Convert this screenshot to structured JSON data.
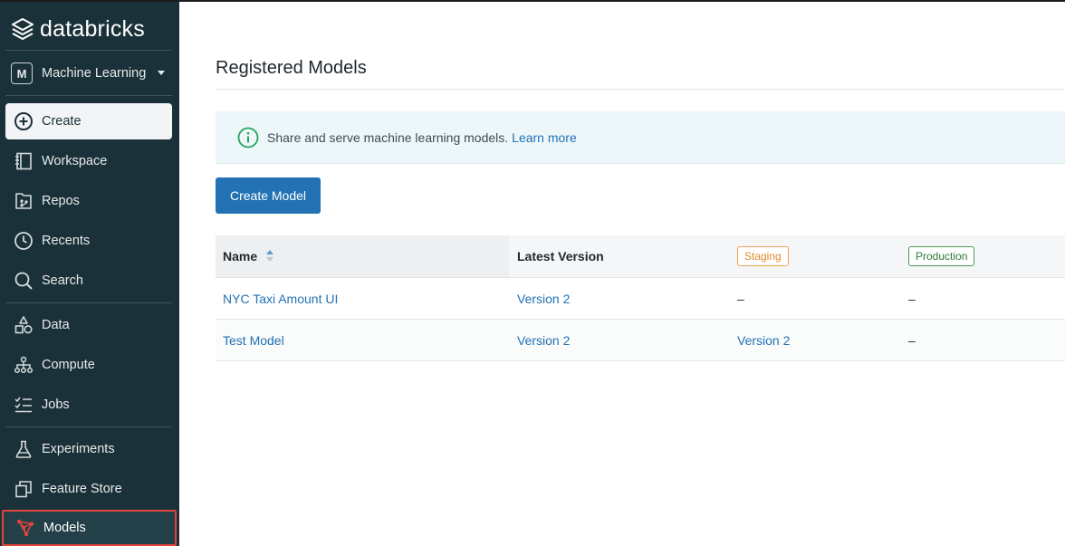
{
  "app": {
    "brand": "databricks"
  },
  "sidebar": {
    "persona": {
      "badge": "M",
      "label": "Machine Learning"
    },
    "items": [
      {
        "label": "Create",
        "icon": "plus-circle-icon"
      },
      {
        "label": "Workspace",
        "icon": "workspace-icon"
      },
      {
        "label": "Repos",
        "icon": "repos-icon"
      },
      {
        "label": "Recents",
        "icon": "clock-icon"
      },
      {
        "label": "Search",
        "icon": "search-icon"
      },
      {
        "label": "Data",
        "icon": "data-icon"
      },
      {
        "label": "Compute",
        "icon": "compute-icon"
      },
      {
        "label": "Jobs",
        "icon": "jobs-icon"
      },
      {
        "label": "Experiments",
        "icon": "flask-icon"
      },
      {
        "label": "Feature Store",
        "icon": "feature-store-icon"
      },
      {
        "label": "Models",
        "icon": "models-icon"
      }
    ],
    "highlight_color": "#e0453a"
  },
  "main": {
    "title": "Registered Models",
    "banner": {
      "text": "Share and serve machine learning models.",
      "link": "Learn more"
    },
    "create_button": "Create Model",
    "table": {
      "columns": {
        "name": "Name",
        "latest_version": "Latest Version",
        "staging": "Staging",
        "production": "Production"
      },
      "rows": [
        {
          "name": "NYC Taxi Amount UI",
          "latest_version": "Version 2",
          "staging": "–",
          "production": "–"
        },
        {
          "name": "Test Model",
          "latest_version": "Version 2",
          "staging": "Version 2",
          "production": "–"
        }
      ]
    }
  },
  "colors": {
    "sidebar_bg": "#1b3139",
    "primary": "#2272b4",
    "staging": "#e08a2c",
    "production": "#2a7a33"
  }
}
